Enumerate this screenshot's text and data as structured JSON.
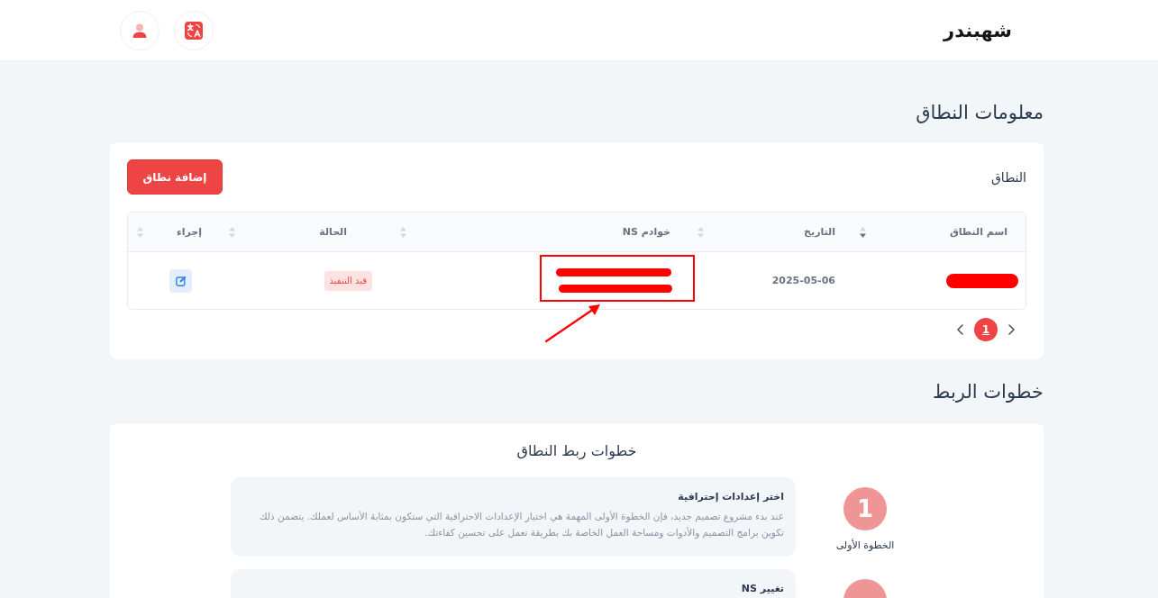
{
  "header": {
    "logo": "شهبندر"
  },
  "domain_info": {
    "title": "معلومات النطاق",
    "card_label": "النطاق",
    "add_button": "إضافة نطاق",
    "table": {
      "columns": [
        {
          "label": "اسم النطاق",
          "sorted": true
        },
        {
          "label": "التاريخ",
          "sorted": false
        },
        {
          "label": "خوادم NS",
          "sorted": false
        },
        {
          "label": "الحالة",
          "sorted": false
        },
        {
          "label": "إجراء",
          "sorted": false
        }
      ],
      "rows": [
        {
          "domain": {
            "redacted": true
          },
          "date": "2025-05-06",
          "ns_servers": [
            {
              "redacted": true
            },
            {
              "redacted": true
            }
          ],
          "ns_marked": true,
          "status": {
            "label": "قيد التنفيذ",
            "kind": "pending"
          },
          "action": {
            "kind": "edit"
          }
        }
      ]
    },
    "pagination": {
      "pages": [
        {
          "label": "1",
          "selected": true
        }
      ]
    }
  },
  "linking_steps": {
    "title": "خطوات الربط",
    "card_title": "خطوات ربط النطاق",
    "steps": [
      {
        "number": "1",
        "label": "الخطوة الأولى",
        "title": "اختر إعدادات إحترافية",
        "description": "عند بدء مشروع تصميم جديد، فإن الخطوة الأولى المهمة هي اختيار الإعدادات الاحترافية التي ستكون بمثابة الأساس لعملك. يتضمن ذلك تكوين برامج التصميم والأدوات ومساحة العمل الخاصة بك بطريقة تعمل على تحسين كفاءتك."
      },
      {
        "title": "تغيير NS"
      }
    ]
  }
}
